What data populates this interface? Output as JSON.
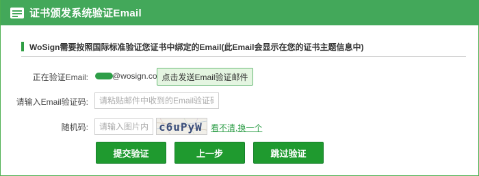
{
  "window": {
    "title": "证书颁发系统验证Email",
    "icon": "id-card-icon"
  },
  "notice": {
    "text": "WoSign需要按照国际标准验证您证书中绑定的Email(此Email会显示在您的证书主题信息中)"
  },
  "form": {
    "email_label": "正在验证Email:",
    "email_domain": "@wosign.com",
    "send_button_label": "点击发送Email验证邮件",
    "code_label": "请输入Email验证码:",
    "code_placeholder": "请粘贴邮件中收到的Email验证码",
    "captcha_label": "随机码:",
    "captcha_placeholder": "请输入图片内容",
    "captcha_text": "c6uPyW",
    "refresh_link": "看不清,换一个"
  },
  "actions": {
    "submit_label": "提交验证",
    "prev_label": "上一步",
    "skip_label": "跳过验证"
  },
  "colors": {
    "titlebar": "#43a85a",
    "button": "#1f9a2f",
    "accent": "#2e9e48"
  }
}
